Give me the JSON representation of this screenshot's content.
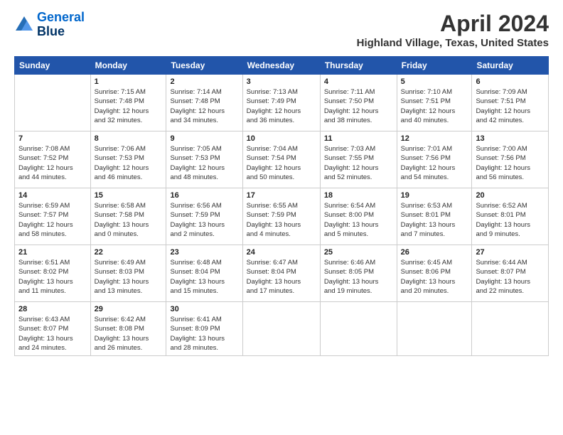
{
  "header": {
    "logo_line1": "General",
    "logo_line2": "Blue",
    "title": "April 2024",
    "location": "Highland Village, Texas, United States"
  },
  "weekdays": [
    "Sunday",
    "Monday",
    "Tuesday",
    "Wednesday",
    "Thursday",
    "Friday",
    "Saturday"
  ],
  "weeks": [
    [
      {
        "day": "",
        "info": ""
      },
      {
        "day": "1",
        "info": "Sunrise: 7:15 AM\nSunset: 7:48 PM\nDaylight: 12 hours\nand 32 minutes."
      },
      {
        "day": "2",
        "info": "Sunrise: 7:14 AM\nSunset: 7:48 PM\nDaylight: 12 hours\nand 34 minutes."
      },
      {
        "day": "3",
        "info": "Sunrise: 7:13 AM\nSunset: 7:49 PM\nDaylight: 12 hours\nand 36 minutes."
      },
      {
        "day": "4",
        "info": "Sunrise: 7:11 AM\nSunset: 7:50 PM\nDaylight: 12 hours\nand 38 minutes."
      },
      {
        "day": "5",
        "info": "Sunrise: 7:10 AM\nSunset: 7:51 PM\nDaylight: 12 hours\nand 40 minutes."
      },
      {
        "day": "6",
        "info": "Sunrise: 7:09 AM\nSunset: 7:51 PM\nDaylight: 12 hours\nand 42 minutes."
      }
    ],
    [
      {
        "day": "7",
        "info": "Sunrise: 7:08 AM\nSunset: 7:52 PM\nDaylight: 12 hours\nand 44 minutes."
      },
      {
        "day": "8",
        "info": "Sunrise: 7:06 AM\nSunset: 7:53 PM\nDaylight: 12 hours\nand 46 minutes."
      },
      {
        "day": "9",
        "info": "Sunrise: 7:05 AM\nSunset: 7:53 PM\nDaylight: 12 hours\nand 48 minutes."
      },
      {
        "day": "10",
        "info": "Sunrise: 7:04 AM\nSunset: 7:54 PM\nDaylight: 12 hours\nand 50 minutes."
      },
      {
        "day": "11",
        "info": "Sunrise: 7:03 AM\nSunset: 7:55 PM\nDaylight: 12 hours\nand 52 minutes."
      },
      {
        "day": "12",
        "info": "Sunrise: 7:01 AM\nSunset: 7:56 PM\nDaylight: 12 hours\nand 54 minutes."
      },
      {
        "day": "13",
        "info": "Sunrise: 7:00 AM\nSunset: 7:56 PM\nDaylight: 12 hours\nand 56 minutes."
      }
    ],
    [
      {
        "day": "14",
        "info": "Sunrise: 6:59 AM\nSunset: 7:57 PM\nDaylight: 12 hours\nand 58 minutes."
      },
      {
        "day": "15",
        "info": "Sunrise: 6:58 AM\nSunset: 7:58 PM\nDaylight: 13 hours\nand 0 minutes."
      },
      {
        "day": "16",
        "info": "Sunrise: 6:56 AM\nSunset: 7:59 PM\nDaylight: 13 hours\nand 2 minutes."
      },
      {
        "day": "17",
        "info": "Sunrise: 6:55 AM\nSunset: 7:59 PM\nDaylight: 13 hours\nand 4 minutes."
      },
      {
        "day": "18",
        "info": "Sunrise: 6:54 AM\nSunset: 8:00 PM\nDaylight: 13 hours\nand 5 minutes."
      },
      {
        "day": "19",
        "info": "Sunrise: 6:53 AM\nSunset: 8:01 PM\nDaylight: 13 hours\nand 7 minutes."
      },
      {
        "day": "20",
        "info": "Sunrise: 6:52 AM\nSunset: 8:01 PM\nDaylight: 13 hours\nand 9 minutes."
      }
    ],
    [
      {
        "day": "21",
        "info": "Sunrise: 6:51 AM\nSunset: 8:02 PM\nDaylight: 13 hours\nand 11 minutes."
      },
      {
        "day": "22",
        "info": "Sunrise: 6:49 AM\nSunset: 8:03 PM\nDaylight: 13 hours\nand 13 minutes."
      },
      {
        "day": "23",
        "info": "Sunrise: 6:48 AM\nSunset: 8:04 PM\nDaylight: 13 hours\nand 15 minutes."
      },
      {
        "day": "24",
        "info": "Sunrise: 6:47 AM\nSunset: 8:04 PM\nDaylight: 13 hours\nand 17 minutes."
      },
      {
        "day": "25",
        "info": "Sunrise: 6:46 AM\nSunset: 8:05 PM\nDaylight: 13 hours\nand 19 minutes."
      },
      {
        "day": "26",
        "info": "Sunrise: 6:45 AM\nSunset: 8:06 PM\nDaylight: 13 hours\nand 20 minutes."
      },
      {
        "day": "27",
        "info": "Sunrise: 6:44 AM\nSunset: 8:07 PM\nDaylight: 13 hours\nand 22 minutes."
      }
    ],
    [
      {
        "day": "28",
        "info": "Sunrise: 6:43 AM\nSunset: 8:07 PM\nDaylight: 13 hours\nand 24 minutes."
      },
      {
        "day": "29",
        "info": "Sunrise: 6:42 AM\nSunset: 8:08 PM\nDaylight: 13 hours\nand 26 minutes."
      },
      {
        "day": "30",
        "info": "Sunrise: 6:41 AM\nSunset: 8:09 PM\nDaylight: 13 hours\nand 28 minutes."
      },
      {
        "day": "",
        "info": ""
      },
      {
        "day": "",
        "info": ""
      },
      {
        "day": "",
        "info": ""
      },
      {
        "day": "",
        "info": ""
      }
    ]
  ]
}
